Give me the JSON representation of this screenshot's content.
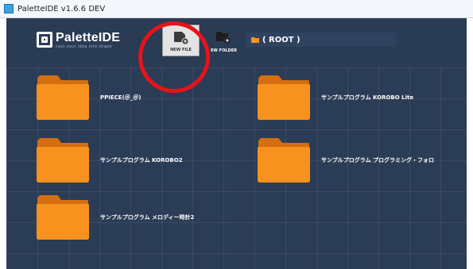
{
  "window": {
    "title": "PaletteIDE v1.6.6 DEV"
  },
  "logo": {
    "name": "PaletteIDE",
    "tagline": "cast your idea into shape"
  },
  "toolbar": {
    "new_file_label": "NEW FILE",
    "new_folder_label": "EW FOLDER"
  },
  "path": {
    "current": "( ROOT )"
  },
  "colors": {
    "accent_folder": "#f7921e",
    "background": "#2b3c56",
    "highlight": "#e8131a"
  },
  "items": [
    {
      "name": "PPIECE(＠_＠)",
      "icon": "folder-icon"
    },
    {
      "name": "サンプルプログラム KOROBO Lite",
      "icon": "folder-icon"
    },
    {
      "name": "サンプルプログラム KOROBO2",
      "icon": "folder-icon"
    },
    {
      "name": "サンプルプログラム プログラミング・フォロ",
      "icon": "folder-icon"
    },
    {
      "name": "サンプルプログラム メロディー時計2",
      "icon": "folder-icon"
    }
  ]
}
